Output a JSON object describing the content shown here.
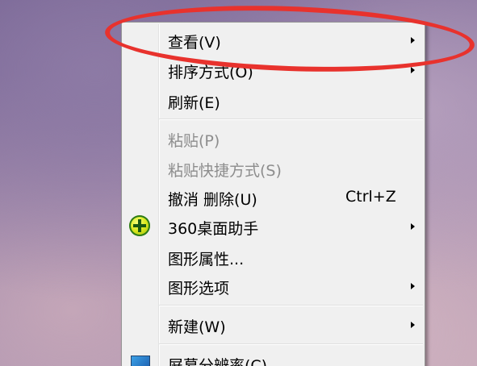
{
  "context_menu": {
    "items": [
      {
        "label": "查看(V)",
        "has_submenu": true,
        "disabled": false
      },
      {
        "label": "排序方式(O)",
        "has_submenu": true,
        "disabled": false
      },
      {
        "label": "刷新(E)",
        "has_submenu": false,
        "disabled": false
      },
      {
        "label": "粘贴(P)",
        "has_submenu": false,
        "disabled": true
      },
      {
        "label": "粘贴快捷方式(S)",
        "has_submenu": false,
        "disabled": true
      },
      {
        "label": "撤消 删除(U)",
        "shortcut": "Ctrl+Z",
        "has_submenu": false,
        "disabled": false
      },
      {
        "label": "360桌面助手",
        "icon": "360-plus-icon",
        "has_submenu": true,
        "disabled": false
      },
      {
        "label": "图形属性...",
        "has_submenu": false,
        "disabled": false
      },
      {
        "label": "图形选项",
        "has_submenu": true,
        "disabled": false
      },
      {
        "label": "新建(W)",
        "has_submenu": true,
        "disabled": false
      },
      {
        "label": "屏幕分辨率(C)",
        "icon": "screen-resolution-icon",
        "has_submenu": false,
        "disabled": false
      }
    ]
  },
  "annotation": {
    "color": "#e8322d",
    "shape": "ellipse"
  }
}
